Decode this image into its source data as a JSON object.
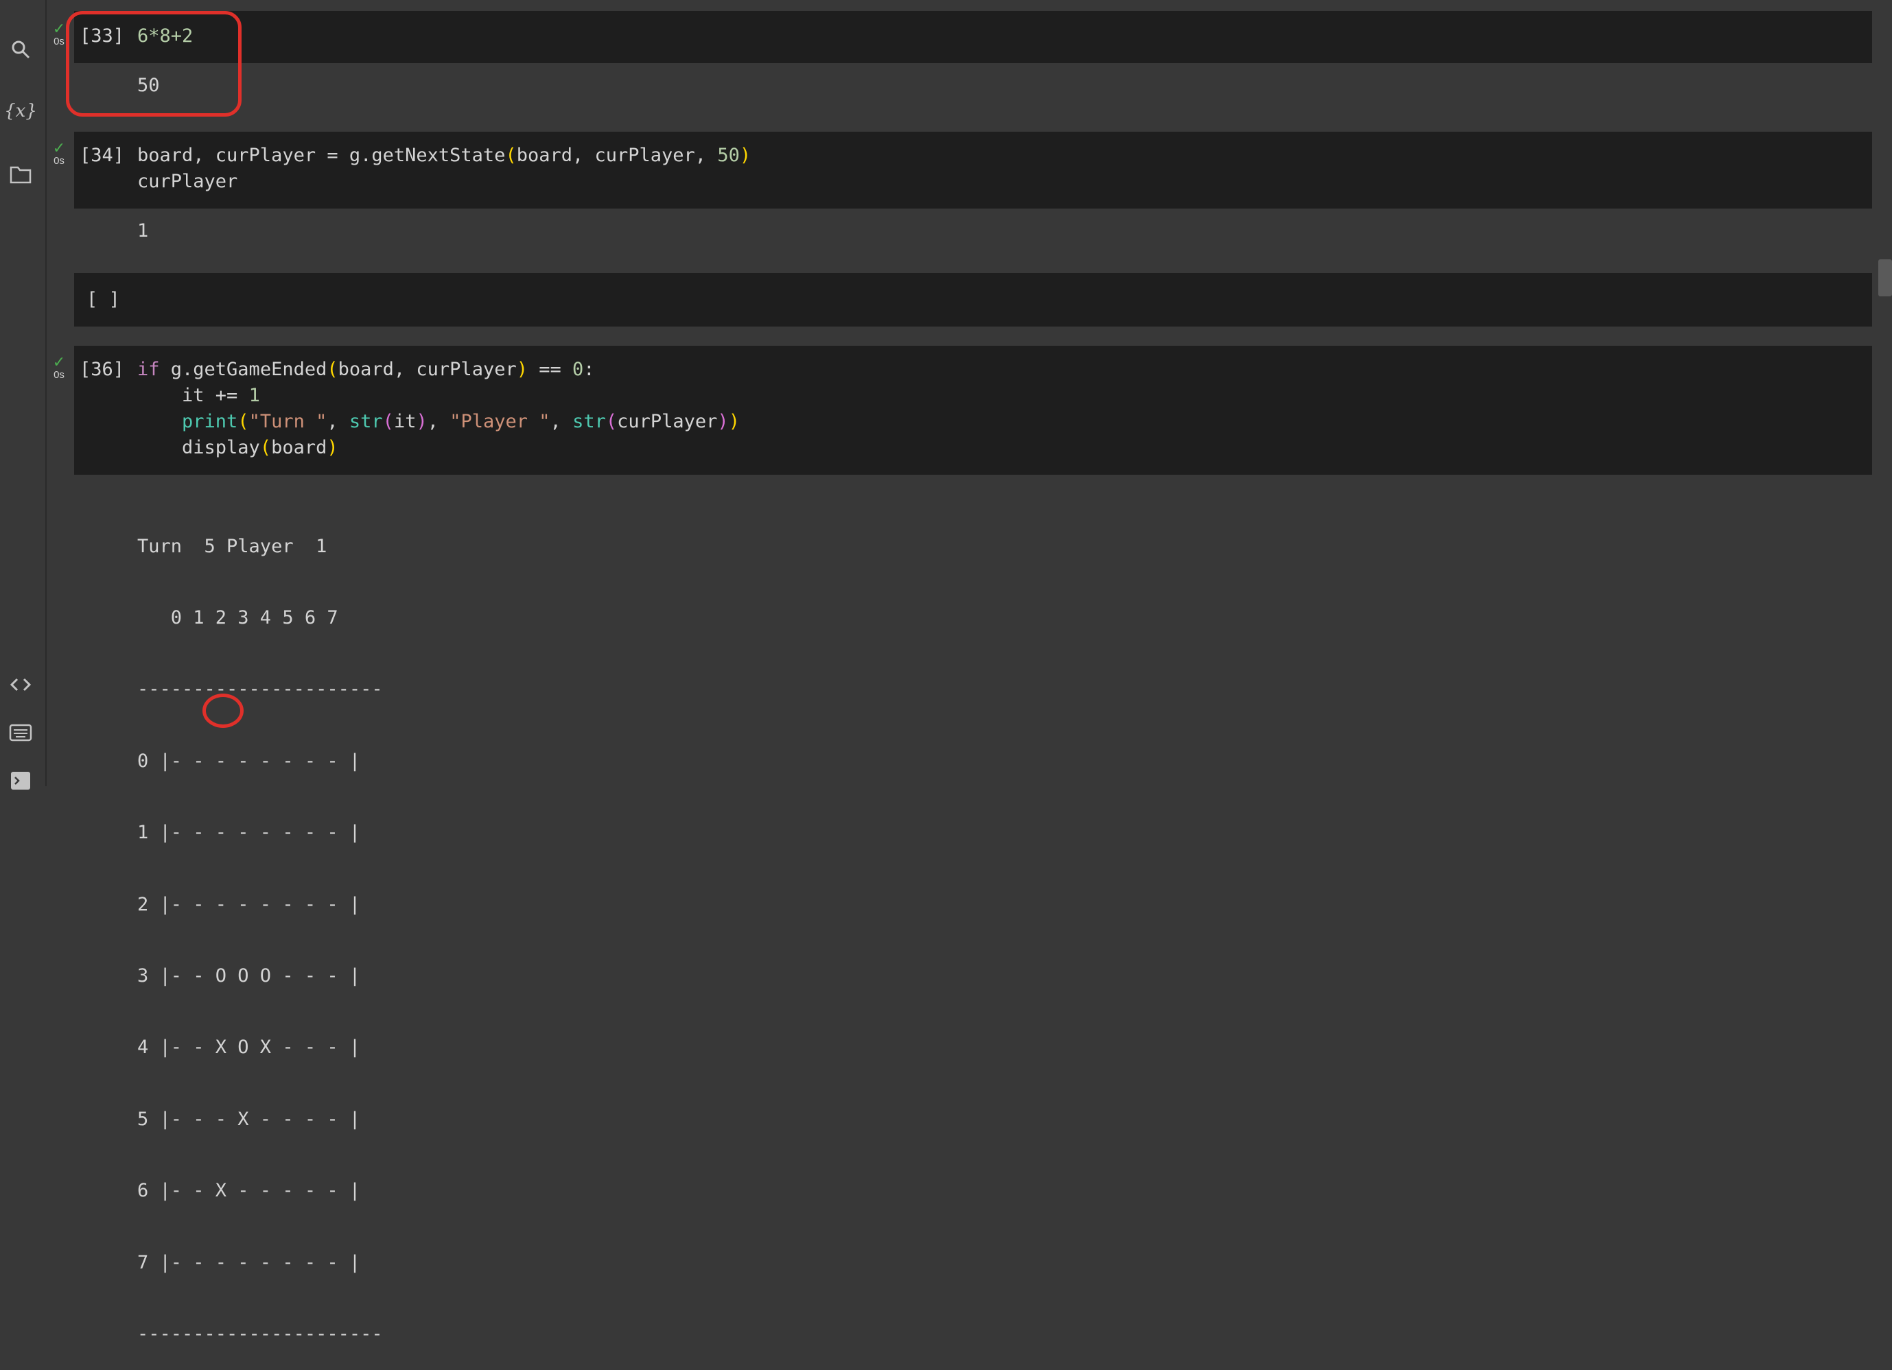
{
  "sidebar": {
    "icons": [
      "search-icon",
      "variables-icon",
      "folder-icon",
      "code-snippets-icon",
      "command-palette-icon",
      "terminal-icon"
    ],
    "variables_glyph": "{x}"
  },
  "cells": [
    {
      "prompt": "[33]",
      "status_time": "0s",
      "code": "6*8+2",
      "output": "50"
    },
    {
      "prompt": "[34]",
      "status_time": "0s",
      "code_line1_a": "board, curPlayer = g.getNextState",
      "code_line1_b": "(",
      "code_line1_c": "board, curPlayer, ",
      "code_line1_d": "50",
      "code_line1_e": ")",
      "code_line2": "curPlayer",
      "output": "1"
    },
    {
      "prompt": "[ ]"
    },
    {
      "prompt": "[36]",
      "status_time": "0s",
      "l1_kw": "if",
      "l1_a": " g.getGameEnded",
      "l1_b": "(",
      "l1_c": "board, curPlayer",
      "l1_d": ")",
      "l1_e": " == ",
      "l1_f": "0",
      "l1_g": ":",
      "l2_a": "    it += ",
      "l2_b": "1",
      "l3_a": "    print",
      "l3_b": "(",
      "l3_c": "\"Turn \"",
      "l3_d": ", ",
      "l3_e": "str",
      "l3_f": "(",
      "l3_g": "it",
      "l3_h": ")",
      "l3_i": ", ",
      "l3_j": "\"Player \"",
      "l3_k": ", ",
      "l3_l": "str",
      "l3_m": "(",
      "l3_n": "curPlayer",
      "l3_o": ")",
      "l3_p": ")",
      "l4_a": "    display",
      "l4_b": "(",
      "l4_c": "board",
      "l4_d": ")",
      "output_lines": [
        "Turn  5 Player  1",
        "   0 1 2 3 4 5 6 7",
        "----------------------",
        "0 |- - - - - - - - |",
        "1 |- - - - - - - - |",
        "2 |- - - - - - - - |",
        "3 |- - O O O - - - |",
        "4 |- - X O X - - - |",
        "5 |- - - X - - - - |",
        "6 |- - X - - - - - |",
        "7 |- - - - - - - - |",
        "----------------------"
      ]
    }
  ],
  "colors": {
    "annotation": "#e0302a",
    "success_check": "#4caf50"
  }
}
